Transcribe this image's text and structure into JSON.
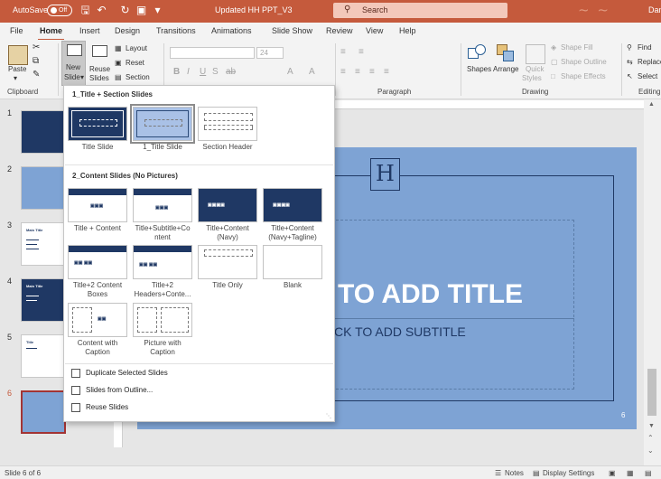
{
  "titlebar": {
    "autosave_label": "AutoSave",
    "autosave_state": "Off",
    "doc_title": "Updated HH PPT_V3",
    "search_placeholder": "Search",
    "user": "Dan"
  },
  "menu": {
    "tabs": [
      "File",
      "Home",
      "Insert",
      "Design",
      "Transitions",
      "Animations",
      "Slide Show",
      "Review",
      "View",
      "Help"
    ],
    "active": "Home"
  },
  "ribbon": {
    "clipboard": {
      "paste": "Paste",
      "label": "Clipboard"
    },
    "slides": {
      "new_slide_line1": "New",
      "new_slide_line2": "Slide",
      "reuse_line1": "Reuse",
      "reuse_line2": "Slides",
      "layout": "Layout",
      "reset": "Reset",
      "section": "Section"
    },
    "font": {
      "size": "24"
    },
    "paragraph": {
      "label": "Paragraph"
    },
    "drawing": {
      "shapes": "Shapes",
      "arrange": "Arrange",
      "quick_line1": "Quick",
      "quick_line2": "Styles",
      "shape_fill": "Shape Fill",
      "shape_outline": "Shape Outline",
      "shape_effects": "Shape Effects",
      "label": "Drawing"
    },
    "editing": {
      "find": "Find",
      "replace": "Replace",
      "select": "Select",
      "label": "Editing"
    }
  },
  "thumbnails": [
    {
      "num": "1"
    },
    {
      "num": "2"
    },
    {
      "num": "3",
      "title": "Main Title"
    },
    {
      "num": "4",
      "title": "Main Title"
    },
    {
      "num": "5",
      "title": "Title"
    },
    {
      "num": "6"
    }
  ],
  "slide": {
    "logo_letter": "H",
    "title": "TO ADD TITLE",
    "subtitle": "CK TO ADD SUBTITLE",
    "number": "6"
  },
  "gallery": {
    "section1": "1_Title + Section Slides",
    "section2": "2_Content Slides (No Pictures)",
    "layouts1": [
      {
        "line1": "Title Slide",
        "line2": ""
      },
      {
        "line1": "1_Title Slide",
        "line2": ""
      },
      {
        "line1": "Section Header",
        "line2": ""
      }
    ],
    "layouts2": [
      {
        "line1": "Title + Content",
        "line2": ""
      },
      {
        "line1": "Title+Subtitle+Co",
        "line2": "ntent"
      },
      {
        "line1": "Title+Content",
        "line2": "(Navy)"
      },
      {
        "line1": "Title+Content",
        "line2": "(Navy+Tagline)"
      },
      {
        "line1": "Title+2 Content",
        "line2": "Boxes"
      },
      {
        "line1": "Title+2",
        "line2": "Headers+Conte..."
      },
      {
        "line1": "Title Only",
        "line2": ""
      },
      {
        "line1": "Blank",
        "line2": ""
      },
      {
        "line1": "Content with",
        "line2": "Caption"
      },
      {
        "line1": "Picture with",
        "line2": "Caption"
      }
    ],
    "actions": {
      "duplicate": "Duplicate Selected Slides",
      "outline": "Slides from Outline...",
      "reuse": "Reuse Slides"
    }
  },
  "statusbar": {
    "slide_count": "Slide 6 of 6",
    "notes": "Notes",
    "display": "Display Settings"
  },
  "colors": {
    "accent": "#c55a3c",
    "navy": "#1f3864",
    "slide_blue": "#7ea3d4"
  }
}
